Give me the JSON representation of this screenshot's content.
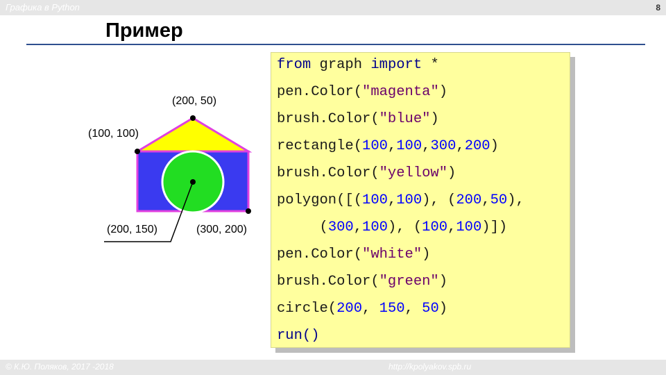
{
  "header": {
    "course_title": "Графика в Python",
    "page_number": "8"
  },
  "slide": {
    "title": "Пример"
  },
  "drawing": {
    "colors": {
      "pen_house": "#e040e0",
      "rect_fill": "#3a3af0",
      "roof_fill": "#ffff00",
      "circle_fill": "#22dd22",
      "circle_pen": "#ffffff",
      "points": "#000000"
    },
    "labels": {
      "top": "(200, 50)",
      "left": "(100, 100)",
      "bottom_left": "(200, 150)",
      "bottom_right": "(300, 200)"
    }
  },
  "code": {
    "line1": {
      "a": "from",
      "b": " graph ",
      "c": "import",
      "d": " *"
    },
    "line2": {
      "a": "pen.Color(",
      "b": "\"magenta\"",
      "c": ")"
    },
    "line3": {
      "a": "brush.Color(",
      "b": "\"blue\"",
      "c": ")"
    },
    "line4": {
      "a": "rectangle(",
      "b": "100",
      "c": ",",
      "d": "100",
      "e": ",",
      "f": "300",
      "g": ",",
      "h": "200",
      "i": ")"
    },
    "line5": {
      "a": "brush.Color(",
      "b": "\"yellow\"",
      "c": ")"
    },
    "line6": {
      "a": "polygon([(",
      "b": "100",
      "c": ",",
      "d": "100",
      "e": "), (",
      "f": "200",
      "g": ",",
      "h": "50",
      "i": "),"
    },
    "line7": {
      "a": "     (",
      "b": "300",
      "c": ",",
      "d": "100",
      "e": "), (",
      "f": "100",
      "g": ",",
      "h": "100",
      "i": ")])"
    },
    "line8": {
      "a": "pen.Color(",
      "b": "\"white\"",
      "c": ")"
    },
    "line9": {
      "a": "brush.Color(",
      "b": "\"green\"",
      "c": ")"
    },
    "line10": {
      "a": "circle(",
      "b": "200",
      "c": ", ",
      "d": "150",
      "e": ", ",
      "f": "50",
      "g": ")"
    },
    "line11": {
      "a": "run()"
    }
  },
  "footer": {
    "author": "© К.Ю. Поляков, 2017 -2018",
    "url": "http://kpolyakov.spb.ru"
  }
}
